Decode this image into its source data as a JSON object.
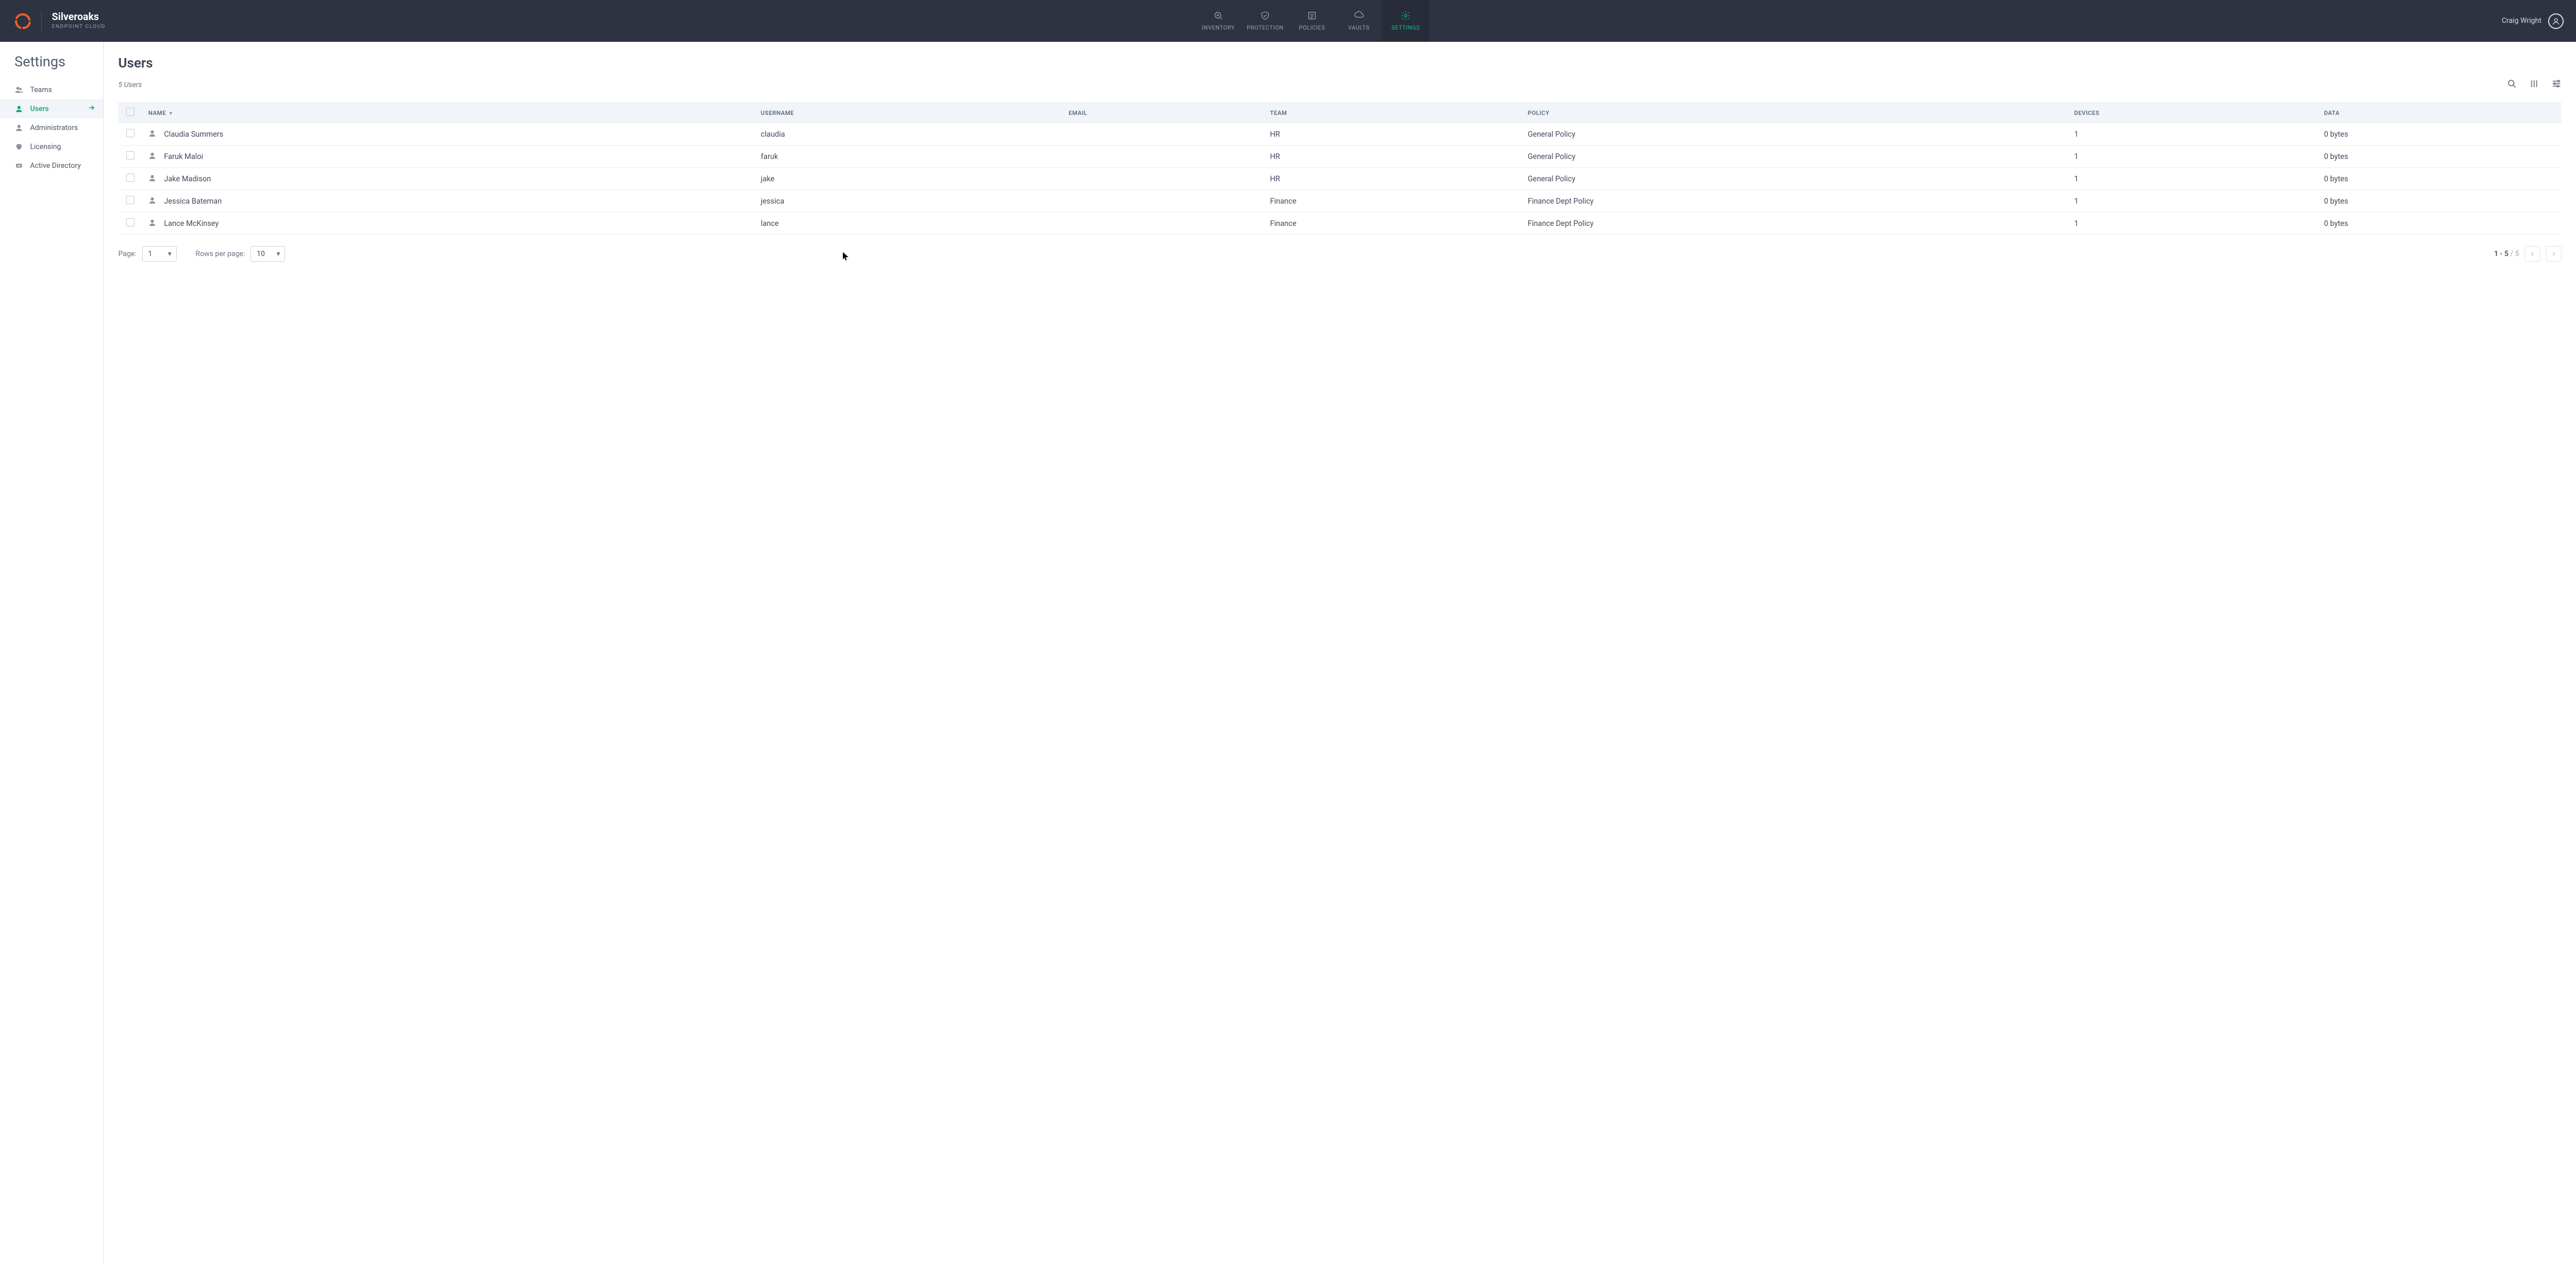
{
  "brand": {
    "name": "Silveroaks",
    "sub": "ENDPOINT CLOUD"
  },
  "nav": {
    "inventory": "INVENTORY",
    "protection": "PROTECTION",
    "policies": "POLICIES",
    "vaults": "VAULTS",
    "settings": "SETTINGS"
  },
  "current_user": "Craig Wright",
  "sidebar": {
    "title": "Settings",
    "items": [
      {
        "label": "Teams"
      },
      {
        "label": "Users"
      },
      {
        "label": "Administrators"
      },
      {
        "label": "Licensing"
      },
      {
        "label": "Active Directory"
      }
    ]
  },
  "page": {
    "title": "Users",
    "count_text": "5 Users"
  },
  "table": {
    "headers": {
      "name": "NAME",
      "username": "USERNAME",
      "email": "EMAIL",
      "team": "TEAM",
      "policy": "POLICY",
      "devices": "DEVICES",
      "data": "DATA"
    },
    "rows": [
      {
        "name": "Claudia Summers",
        "username": "claudia",
        "email": "",
        "team": "HR",
        "policy": "General Policy",
        "devices": "1",
        "data": "0 bytes"
      },
      {
        "name": "Faruk Maloi",
        "username": "faruk",
        "email": "",
        "team": "HR",
        "policy": "General Policy",
        "devices": "1",
        "data": "0 bytes"
      },
      {
        "name": "Jake Madison",
        "username": "jake",
        "email": "",
        "team": "HR",
        "policy": "General Policy",
        "devices": "1",
        "data": "0 bytes"
      },
      {
        "name": "Jessica Bateman",
        "username": "jessica",
        "email": "",
        "team": "Finance",
        "policy": "Finance Dept Policy",
        "devices": "1",
        "data": "0 bytes"
      },
      {
        "name": "Lance McKinsey",
        "username": "lance",
        "email": "",
        "team": "Finance",
        "policy": "Finance Dept Policy",
        "devices": "1",
        "data": "0 bytes"
      }
    ]
  },
  "pagination": {
    "page_label": "Page:",
    "page_value": "1",
    "rows_label": "Rows per page:",
    "rows_value": "10",
    "range_current": "1 - 5",
    "range_sep": " / ",
    "range_total": "5"
  }
}
